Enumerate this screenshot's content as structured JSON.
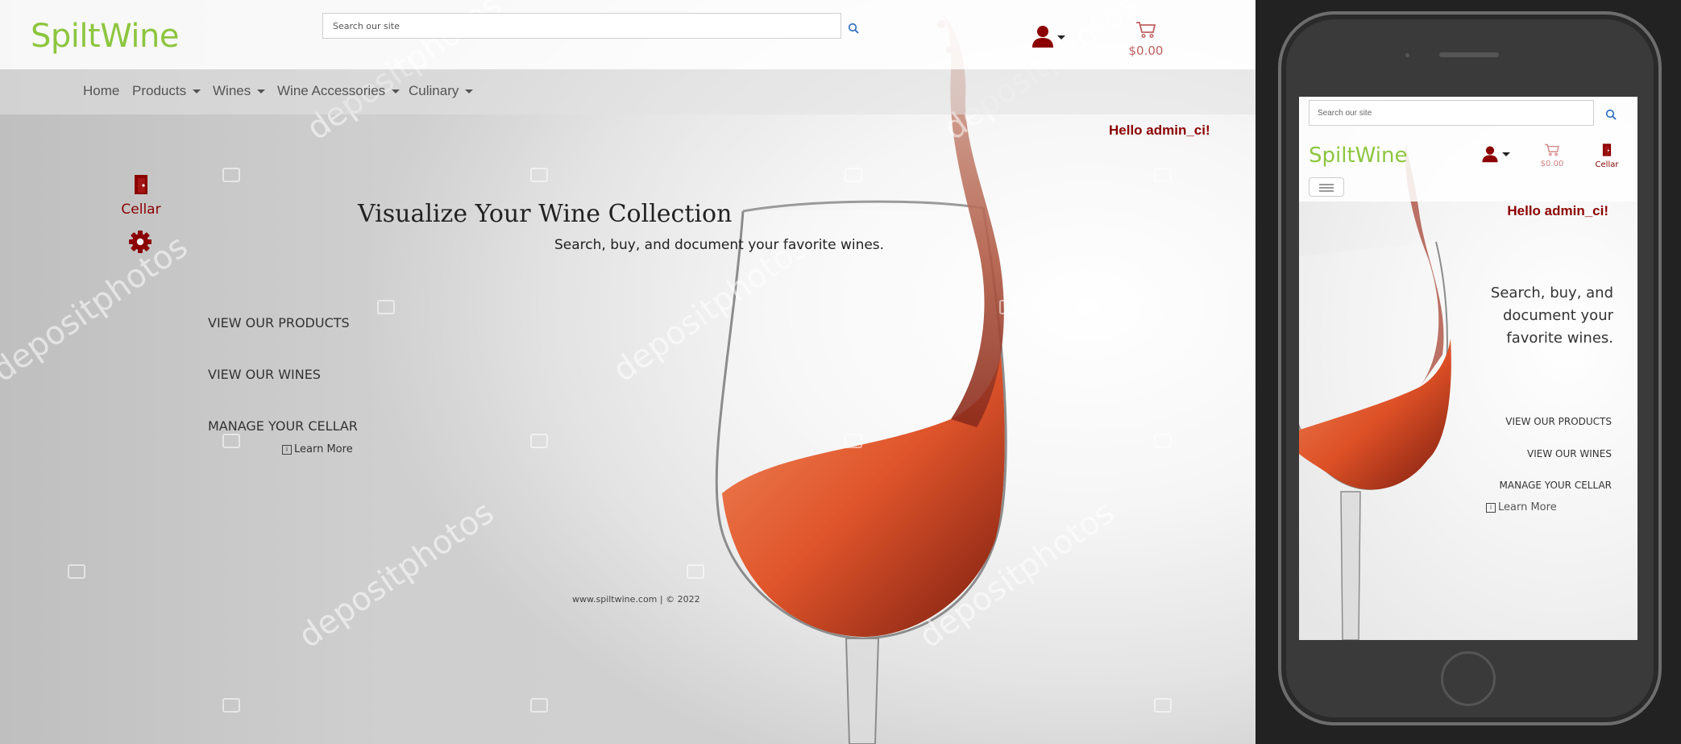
{
  "brand": {
    "name": "SpiltWine",
    "accent": "#8dc63f",
    "wine_red": "#8b0000"
  },
  "search": {
    "placeholder": "Search our site",
    "icon": "search-icon"
  },
  "user_menu": {
    "icon": "user-icon"
  },
  "cart": {
    "icon": "cart-icon",
    "total": "$0.00"
  },
  "nav": {
    "items": [
      {
        "label": "Home",
        "dropdown": false
      },
      {
        "label": "Products",
        "dropdown": true
      },
      {
        "label": "Wines",
        "dropdown": true
      },
      {
        "label": "Wine Accessories",
        "dropdown": true
      },
      {
        "label": "Culinary",
        "dropdown": true
      }
    ]
  },
  "greeting": "Hello admin_ci!",
  "sidebar": {
    "cellar_label": "Cellar",
    "cellar_icon": "door-icon",
    "settings_icon": "gear-icon"
  },
  "hero": {
    "title": "Visualize Your Wine Collection",
    "subtitle": "Search, buy, and document your favorite wines."
  },
  "ctas": [
    "VIEW OUR PRODUCTS",
    "VIEW OUR WINES",
    "MANAGE YOUR CELLAR"
  ],
  "learn_more": "Learn More",
  "footer": "www.spiltwine.com | © 2022",
  "watermark": "depositphotos",
  "mobile": {
    "search_placeholder": "Search our site",
    "logo": "SpiltWine",
    "cart_total": "$0.00",
    "cellar_label": "Cellar",
    "greeting": "Hello admin_ci!",
    "subtitle": "Search, buy, and document your favorite wines.",
    "ctas": [
      "VIEW OUR PRODUCTS",
      "VIEW OUR WINES",
      "MANAGE YOUR CELLAR"
    ],
    "learn_more": "Learn More"
  }
}
